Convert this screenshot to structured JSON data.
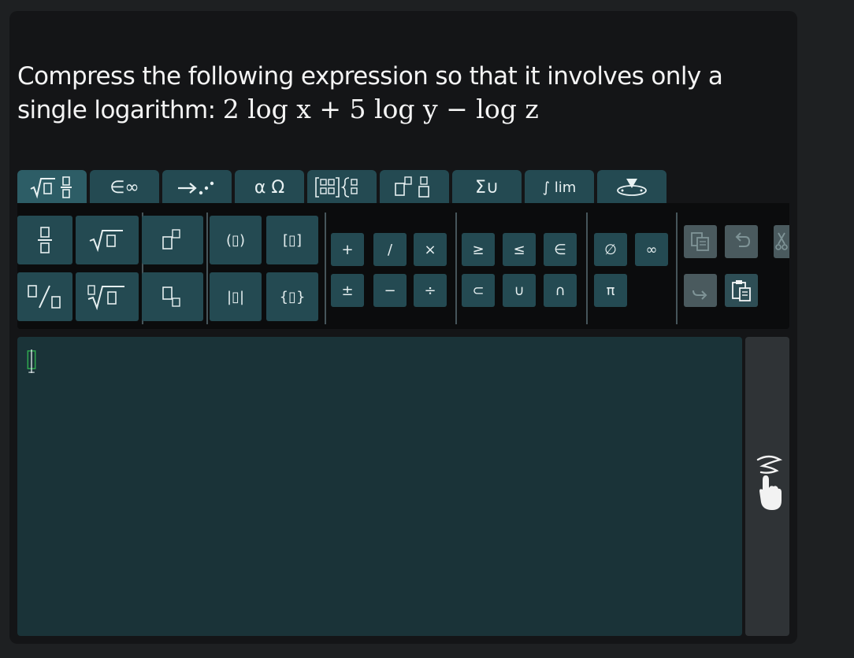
{
  "question": {
    "text": "Compress the following expression so that it involves only a single logarithm: ",
    "math": "2 log x + 5 log y − log z"
  },
  "tabs": [
    {
      "label": "√▯ ▯⁄▯",
      "icon": "roots-fractions-icon"
    },
    {
      "label": "∈∞",
      "icon": "sets-infinity-icon"
    },
    {
      "label": "→⋰",
      "icon": "arrows-dots-icon"
    },
    {
      "label": "α Ω",
      "icon": "greek-letters-icon"
    },
    {
      "label": "[▦]{▦",
      "icon": "matrix-icon"
    },
    {
      "label": "▯▫ ▯",
      "icon": "superscript-subscript-icon"
    },
    {
      "label": "Σ∪",
      "icon": "sum-union-icon"
    },
    {
      "label": "∫ lim",
      "icon": "integral-limit-icon"
    },
    {
      "label": "",
      "icon": "keyboard-toggle-icon"
    }
  ],
  "buttons": {
    "fraction": "▯⁄▯",
    "sqrt": "√▯",
    "power": "▯▫",
    "paren": "(▯)",
    "bracket": "[▯]",
    "plus": "+",
    "slash": "/",
    "times": "×",
    "geq": "≥",
    "leq_lower": "≤",
    "elementof": "∈",
    "emptyset": "∅",
    "infinity": "∞",
    "slash_frac": "▯/▯",
    "nthroot": "∜▯",
    "subscript": "▯▫",
    "abs": "|▯|",
    "brace": "{▯}",
    "plusminus": "±",
    "minus": "−",
    "divide": "÷",
    "subset": "⊂",
    "union": "∪",
    "intersect": "∩",
    "pi": "π"
  },
  "colors": {
    "button_bg": "#244a52",
    "editor_bg": "#1a3338",
    "panel_bg": "#0b0c0d",
    "cursor": "#2fa84f"
  }
}
